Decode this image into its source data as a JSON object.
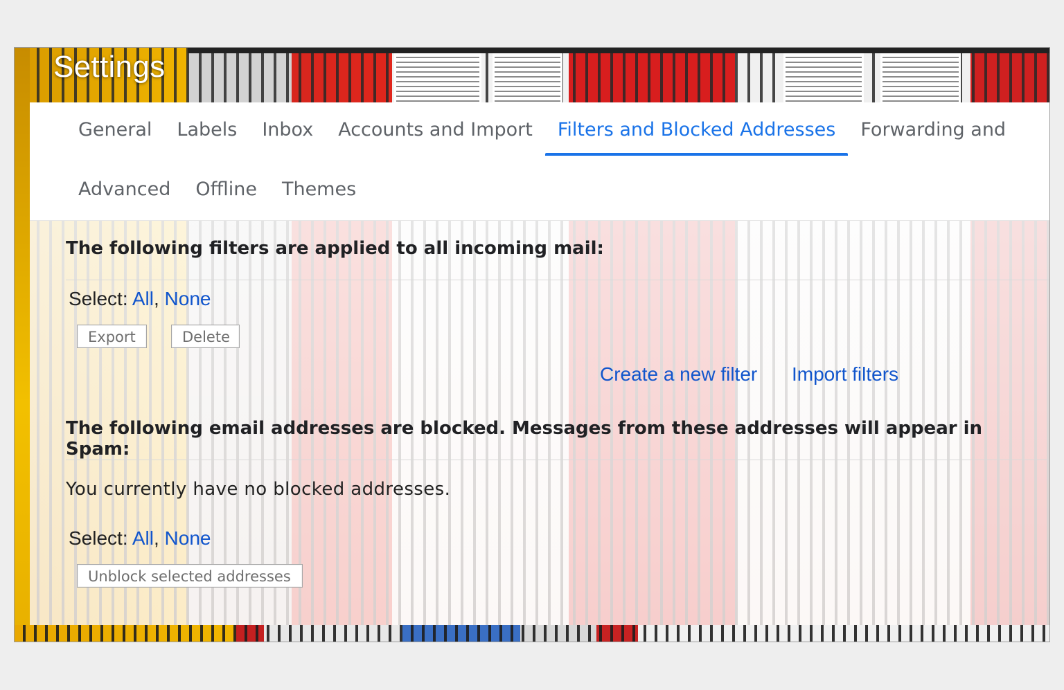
{
  "header": {
    "title": "Settings"
  },
  "tabs": {
    "row1": [
      "General",
      "Labels",
      "Inbox",
      "Accounts and Import",
      "Filters and Blocked Addresses",
      "Forwarding and"
    ],
    "row2": [
      "Advanced",
      "Offline",
      "Themes"
    ],
    "active": "Filters and Blocked Addresses"
  },
  "filters": {
    "heading": "The following filters are applied to all incoming mail:",
    "select_label": "Select: ",
    "select_all": "All",
    "separator": ",",
    "select_none": "None",
    "export_label": "Export",
    "delete_label": "Delete",
    "create_filter_label": "Create a new filter",
    "import_filters_label": "Import filters"
  },
  "blocked": {
    "heading": "The following email addresses are blocked. Messages from these addresses will appear in Spam:",
    "empty_message": "You currently have no blocked addresses.",
    "select_label": "Select: ",
    "select_all": "All",
    "separator": ",",
    "select_none": "None",
    "unblock_label": "Unblock selected addresses"
  },
  "colors": {
    "link": "#1155cc",
    "active_tab": "#1a73e8",
    "tab_text": "#5f6368"
  }
}
